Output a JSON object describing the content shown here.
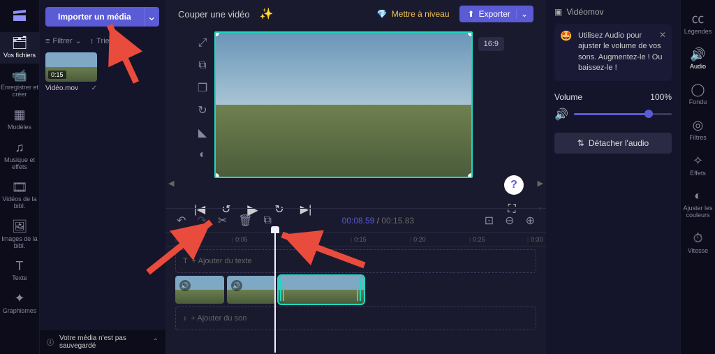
{
  "left_rail": {
    "items": [
      {
        "label": "Vos fichiers"
      },
      {
        "label": "Enregistrer et créer"
      },
      {
        "label": "Modèles"
      },
      {
        "label": "Musique et effets"
      },
      {
        "label": "Vidéos de la bibl."
      },
      {
        "label": "Images de la bibl."
      },
      {
        "label": "Texte"
      },
      {
        "label": "Graphismes"
      }
    ]
  },
  "media": {
    "import": "Importer un média",
    "filter": "Filtrer",
    "sort": "Trier",
    "clip": {
      "dur": "0:15",
      "name": "Vidéo.mov"
    }
  },
  "topbar": {
    "title": "Couper une vidéo",
    "upgrade": "Mettre à niveau",
    "export": "Exporter"
  },
  "preview": {
    "aspect": "16:9"
  },
  "timeline": {
    "current": "00:08.59",
    "duration": "00:15.83",
    "ticks": [
      "|",
      "0:05",
      "0:10",
      "0:15",
      "0:20",
      "0:25",
      "0:30"
    ],
    "add_text": "+ Ajouter du texte",
    "add_sound": "+ Ajouter du son"
  },
  "right_rail": {
    "items": [
      {
        "label": "Légendes"
      },
      {
        "label": "Audio"
      },
      {
        "label": "Fondu"
      },
      {
        "label": "Filtres"
      },
      {
        "label": "Effets"
      },
      {
        "label": "Ajuster les couleurs"
      },
      {
        "label": "Vitesse"
      }
    ]
  },
  "props": {
    "filename": "Vidéomov",
    "tip": "Utilisez Audio pour ajuster le volume de vos sons. Augmentez-le ! Ou baissez-le !",
    "volume_label": "Volume",
    "volume_value": "100%",
    "detach": "Détacher l'audio"
  },
  "savebar": {
    "text": "Votre média n'est pas sauvegardé"
  }
}
